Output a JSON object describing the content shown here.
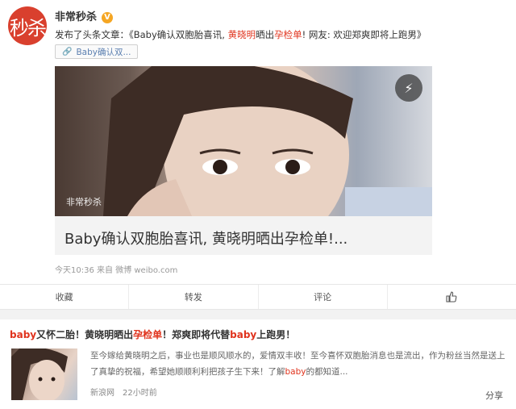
{
  "account": {
    "avatar_text": "秒杀",
    "name": "非常秒杀",
    "verified_badge": "V"
  },
  "post": {
    "prefix": "发布了头条文章：《Baby确认双胞胎喜讯, ",
    "highlight1": "黄晓明",
    "mid1": "晒出",
    "highlight2": "孕检单",
    "suffix": "! 网友: 欢迎郑爽即将上跑男》",
    "link_chip": "Baby确认双..."
  },
  "card": {
    "watermark": "非常秒杀",
    "title": "Baby确认双胞胎喜讯, 黄晓明晒出孕检单!...",
    "bolt_icon": "lightning-icon"
  },
  "meta": {
    "time": "今天10:36",
    "source": "来自 微博 weibo.com"
  },
  "actions": {
    "favorite": "收藏",
    "repost": "转发",
    "comment": "评论",
    "like_icon": "thumbs-up-icon"
  },
  "news": {
    "title_a": "baby",
    "title_b": "又怀二胎！黄晓明晒出",
    "title_c": "孕检单",
    "title_d": "！郑爽即将代替",
    "title_e": "baby",
    "title_f": "上跑男！",
    "text_a": "至今嫁给黄晓明之后，事业也是顺风顺水的，爱情双丰收！至今喜怀双胞胎消息也是流出，作为粉丝当然是送上了真挚的祝福，希望她顺顺利利把孩子生下来！了解",
    "text_b": "baby",
    "text_c": "的都知道...",
    "source": "新浪网",
    "time": "22小时前",
    "share": "分享"
  },
  "colors": {
    "accent_red": "#e0331d",
    "avatar_red": "#d9402e",
    "badge_orange": "#f5a623"
  }
}
